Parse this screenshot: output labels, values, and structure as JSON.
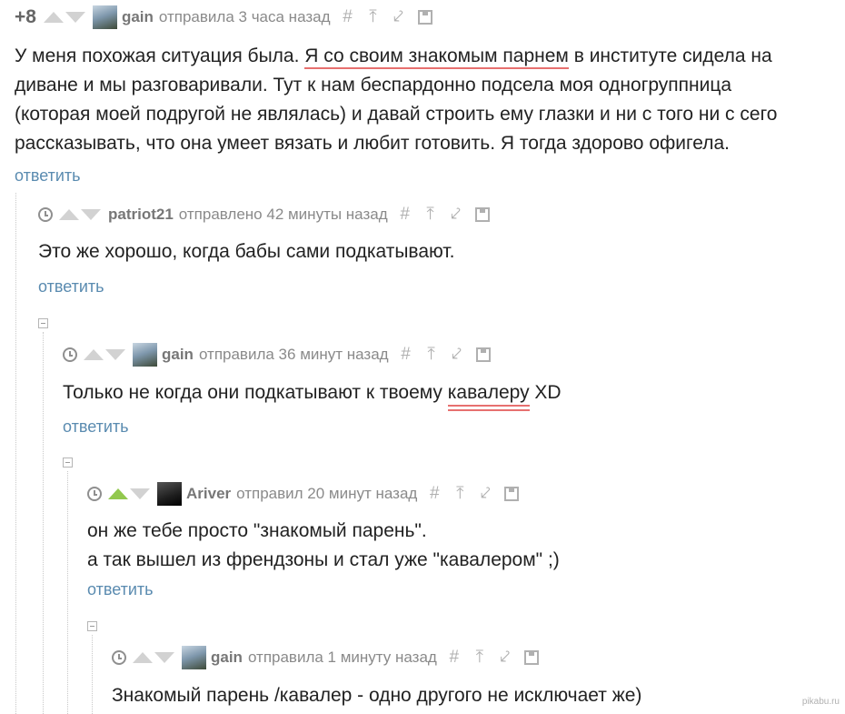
{
  "comments": [
    {
      "rating": "+8",
      "user": "gain",
      "meta": "отправила 3 часа назад",
      "text_pre": "У меня похожая ситуация была. ",
      "text_ul": "Я со своим знакомым парнем",
      "text_post": " в институте сидела на\nдиване и мы разговаривали. Тут к нам беспардонно подсела моя одногруппница\n(которая моей подругой не являлась) и давай строить ему глазки и ни с того ни с сего\nрассказывать, что она умеет вязать и любит готовить. Я тогда здорово офигела.",
      "reply": "ответить"
    },
    {
      "user": "patriot21",
      "meta": "отправлено 42 минуты назад",
      "text": "Это же хорошо, когда бабы сами подкатывают.",
      "reply": "ответить"
    },
    {
      "user": "gain",
      "meta": "отправила 36 минут назад",
      "text_pre": "Только не когда они подкатывают к твоему ",
      "text_ul": "кавалеру",
      "text_post": " XD",
      "reply": "ответить"
    },
    {
      "user": "Ariver",
      "meta": "отправил 20 минут назад",
      "text": "он же тебе просто \"знакомый парень\".\nа так вышел из френдзоны и стал уже \"кавалером\" ;)",
      "reply": "ответить"
    },
    {
      "user": "gain",
      "meta": "отправила 1 минуту назад",
      "text": "Знакомый парень /кавалер - одно другого не исключает же)"
    }
  ],
  "icons": {
    "hash": "#",
    "top": "⤒",
    "parent": "⤦"
  },
  "colors": {
    "link": "#5a8bb0",
    "upvote_active": "#92c84e",
    "underline": "#e7706f"
  },
  "watermark": "pikabu.ru"
}
